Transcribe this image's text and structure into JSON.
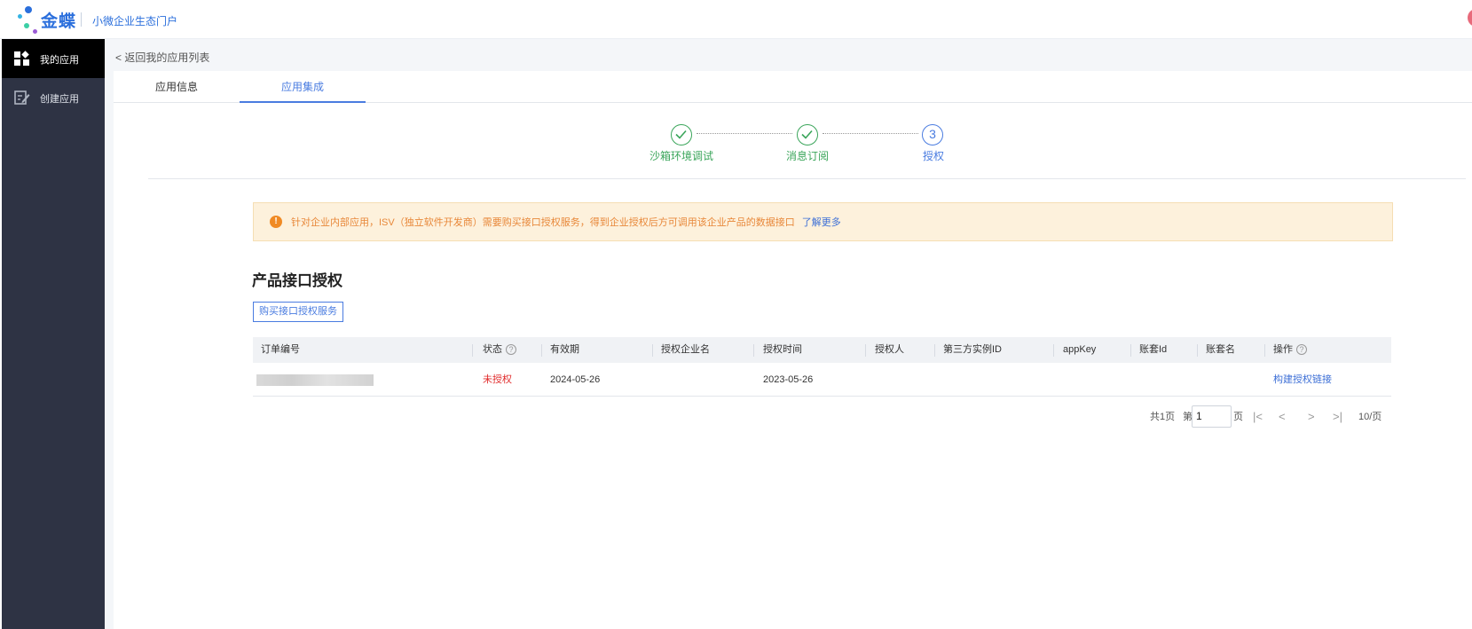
{
  "brand": {
    "name": "金蝶",
    "portal": "小微企业生态门户"
  },
  "sidebar": {
    "items": [
      {
        "label": "我的应用",
        "icon": "apps-grid-icon"
      },
      {
        "label": "创建应用",
        "icon": "edit-doc-icon"
      }
    ]
  },
  "breadcrumb": {
    "back": "< 返回我的应用列表"
  },
  "tabs": [
    {
      "label": "应用信息"
    },
    {
      "label": "应用集成"
    }
  ],
  "steps": [
    {
      "label": "沙箱环境调试",
      "state": "done"
    },
    {
      "label": "消息订阅",
      "state": "done"
    },
    {
      "label": "授权",
      "state": "current",
      "num": "3"
    }
  ],
  "notice": {
    "text": "针对企业内部应用，ISV（独立软件开发商）需要购买接口授权服务，得到企业授权后方可调用该企业产品的数据接口",
    "more": "了解更多"
  },
  "section": {
    "title": "产品接口授权",
    "buy_button": "购买接口授权服务"
  },
  "table": {
    "headers": [
      "订单编号",
      "状态",
      "有效期",
      "授权企业名",
      "授权时间",
      "授权人",
      "第三方实例ID",
      "appKey",
      "账套Id",
      "账套名",
      "操作"
    ],
    "rows": [
      {
        "order_no": "",
        "status": "未授权",
        "valid_until": "2024-05-26",
        "company": "",
        "auth_time": "2023-05-26",
        "authorizer": "",
        "instance_id": "",
        "app_key": "",
        "acct_id": "",
        "acct_name": "",
        "action": "构建授权链接"
      }
    ]
  },
  "pagination": {
    "total": "共1页",
    "page_prefix": "第",
    "page_value": "1",
    "page_suffix": "页",
    "per_page": "10/页"
  },
  "colors": {
    "accent": "#4a7ce0",
    "success": "#3aa55a",
    "danger": "#e02b2b",
    "warning": "#f08a24",
    "sidebar": "#2e3344"
  }
}
